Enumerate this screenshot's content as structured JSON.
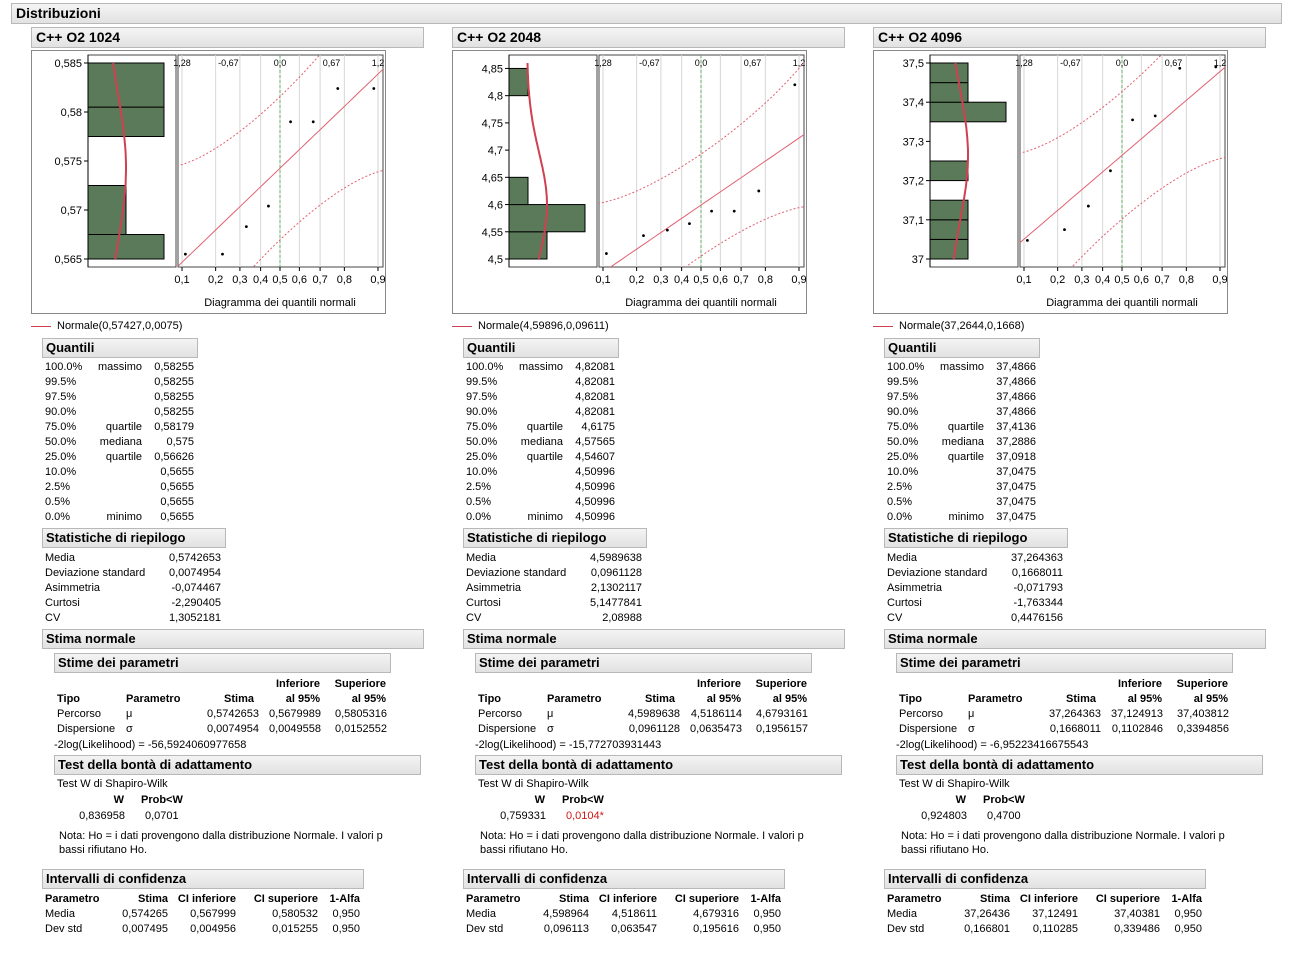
{
  "report_title": "Distribuzioni",
  "labels": {
    "quantiles_title": "Quantili",
    "summary_title": "Statistiche di riepilogo",
    "normal_fit_title": "Stima normale",
    "param_est_title": "Stime dei parametri",
    "gof_title": "Test della bontà di adattamento",
    "ci_title": "Intervalli di confidenza",
    "qq_axis_label": "Diagramma dei quantili normali",
    "qq_top_ticks": [
      "1,28",
      "-0,67",
      "0,0",
      "0,67",
      "1,2"
    ],
    "qq_bottom_ticks": [
      "0,1",
      "0,2",
      "0,3",
      "0,4",
      "0,5",
      "0,6",
      "0,7",
      "0,8",
      "0,9"
    ],
    "quantile_levels": [
      "100.0%",
      "99.5%",
      "97.5%",
      "90.0%",
      "75.0%",
      "50.0%",
      "25.0%",
      "10.0%",
      "2.5%",
      "0.5%",
      "0.0%"
    ],
    "quantile_names": [
      "massimo",
      "",
      "",
      "",
      "quartile",
      "mediana",
      "quartile",
      "",
      "",
      "",
      "minimo"
    ],
    "summary_names": [
      "Media",
      "Deviazione standard",
      "Asimmetria",
      "Curtosi",
      "CV"
    ],
    "pe_headers": {
      "tipo": "Tipo",
      "param": "Parametro",
      "stima": "Stima",
      "inf1": "Inferiore",
      "inf2": "al 95%",
      "sup1": "Superiore",
      "sup2": "al 95%"
    },
    "pe_types": [
      "Percorso",
      "Dispersione"
    ],
    "pe_params": [
      "μ",
      "σ"
    ],
    "loglik_prefix": "-2log(Likelihood) = ",
    "sw_test_name": "Test W di Shapiro-Wilk",
    "sw_w": "W",
    "sw_prob": "Prob<W",
    "gof_note_1": "Nota: Ho = i dati provengono dalla distribuzione Normale. I valori p",
    "gof_note_2": "bassi rifiutano Ho.",
    "ci_headers": [
      "Parametro",
      "Stima",
      "CI inferiore",
      "CI superiore",
      "1-Alfa"
    ],
    "ci_params": [
      "Media",
      "Dev std"
    ]
  },
  "colors": {
    "bar_fill": "#5a7a5a",
    "normal_curve": "#d04050",
    "ref_line": "#e06070",
    "median_line": "#60b060"
  },
  "panels": [
    {
      "title": "C++ O2 1024",
      "y_ticks": [
        "0,585",
        "0,58",
        "0,575",
        "0,57",
        "0,565"
      ],
      "y_range": [
        0.565,
        0.585
      ],
      "y_tick_values": [
        0.585,
        0.58,
        0.575,
        0.57,
        0.565
      ],
      "bins": [
        {
          "lo": 0.565,
          "hi": 0.5675,
          "rel": 1.0
        },
        {
          "lo": 0.5675,
          "hi": 0.5725,
          "rel": 0.5
        },
        {
          "lo": 0.5775,
          "hi": 0.5805,
          "rel": 1.0
        },
        {
          "lo": 0.5805,
          "hi": 0.585,
          "rel": 1.0
        }
      ],
      "qq_points": [
        [
          0.108,
          0.5655
        ],
        [
          0.226,
          0.5655
        ],
        [
          0.33,
          0.5683
        ],
        [
          0.44,
          0.5704
        ],
        [
          0.555,
          0.579
        ],
        [
          0.668,
          0.579
        ],
        [
          0.775,
          0.5824
        ],
        [
          0.89,
          0.5824
        ]
      ],
      "legend": "Normale(0,57427,0,0075)",
      "mean": 0.5742653,
      "sd": 0.0074954,
      "quantile_values": [
        "0,58255",
        "0,58255",
        "0,58255",
        "0,58255",
        "0,58179",
        "0,575",
        "0,56626",
        "0,5655",
        "0,5655",
        "0,5655",
        "0,5655"
      ],
      "summary_values": [
        "0,5742653",
        "0,0074954",
        "-0,074467",
        "-2,290405",
        "1,3052181"
      ],
      "pe_rows": [
        [
          "0,5742653",
          "0,5679989",
          "0,5805316"
        ],
        [
          "0,0074954",
          "0,0049558",
          "0,0152552"
        ]
      ],
      "loglik": "-56,5924060977658",
      "sw": {
        "w": "0,836958",
        "p": "0,0701",
        "sig": false
      },
      "ci_rows": [
        [
          "0,574265",
          "0,567999",
          "0,580532",
          "0,950"
        ],
        [
          "0,007495",
          "0,004956",
          "0,015255",
          "0,950"
        ]
      ]
    },
    {
      "title": "C++ O2 2048",
      "y_ticks": [
        "4,85",
        "4,8",
        "4,75",
        "4,7",
        "4,65",
        "4,6",
        "4,55",
        "4,5"
      ],
      "y_range": [
        4.5,
        4.86
      ],
      "y_tick_values": [
        4.85,
        4.8,
        4.75,
        4.7,
        4.65,
        4.6,
        4.55,
        4.5
      ],
      "bins": [
        {
          "lo": 4.5,
          "hi": 4.55,
          "rel": 0.5
        },
        {
          "lo": 4.55,
          "hi": 4.6,
          "rel": 1.0
        },
        {
          "lo": 4.6,
          "hi": 4.65,
          "rel": 0.25
        },
        {
          "lo": 4.8,
          "hi": 4.85,
          "rel": 0.25
        }
      ],
      "qq_points": [
        [
          0.108,
          4.51
        ],
        [
          0.226,
          4.543
        ],
        [
          0.33,
          4.553
        ],
        [
          0.44,
          4.565
        ],
        [
          0.555,
          4.588
        ],
        [
          0.668,
          4.588
        ],
        [
          0.775,
          4.625
        ],
        [
          0.89,
          4.82
        ]
      ],
      "legend": "Normale(4,59896,0,09611)",
      "mean": 4.5989638,
      "sd": 0.0961128,
      "quantile_values": [
        "4,82081",
        "4,82081",
        "4,82081",
        "4,82081",
        "4,6175",
        "4,57565",
        "4,54607",
        "4,50996",
        "4,50996",
        "4,50996",
        "4,50996"
      ],
      "summary_values": [
        "4,5989638",
        "0,0961128",
        "2,1302117",
        "5,1477841",
        "2,08988"
      ],
      "pe_rows": [
        [
          "4,5989638",
          "4,5186114",
          "4,6793161"
        ],
        [
          "0,0961128",
          "0,0635473",
          "0,1956157"
        ]
      ],
      "loglik": "-15,772703931443",
      "sw": {
        "w": "0,759331",
        "p": "0,0104*",
        "sig": true
      },
      "ci_rows": [
        [
          "4,598964",
          "4,518611",
          "4,679316",
          "0,950"
        ],
        [
          "0,096113",
          "0,063547",
          "0,195616",
          "0,950"
        ]
      ]
    },
    {
      "title": "C++ O2 4096",
      "y_ticks": [
        "37,5",
        "37,4",
        "37,3",
        "37,2",
        "37,1",
        "37"
      ],
      "y_range": [
        37.0,
        37.5
      ],
      "y_tick_values": [
        37.5,
        37.4,
        37.3,
        37.2,
        37.1,
        37.0
      ],
      "bins": [
        {
          "lo": 37.0,
          "hi": 37.05,
          "rel": 0.5
        },
        {
          "lo": 37.05,
          "hi": 37.1,
          "rel": 0.5
        },
        {
          "lo": 37.1,
          "hi": 37.15,
          "rel": 0.5
        },
        {
          "lo": 37.2,
          "hi": 37.25,
          "rel": 0.5
        },
        {
          "lo": 37.35,
          "hi": 37.4,
          "rel": 1.0
        },
        {
          "lo": 37.4,
          "hi": 37.45,
          "rel": 0.5
        },
        {
          "lo": 37.45,
          "hi": 37.5,
          "rel": 0.5
        }
      ],
      "qq_points": [
        [
          0.108,
          37.0475
        ],
        [
          0.226,
          37.075
        ],
        [
          0.33,
          37.135
        ],
        [
          0.44,
          37.225
        ],
        [
          0.555,
          37.355
        ],
        [
          0.668,
          37.365
        ],
        [
          0.775,
          37.4866
        ],
        [
          0.89,
          37.49
        ]
      ],
      "legend": "Normale(37,2644,0,1668)",
      "mean": 37.264363,
      "sd": 0.1668011,
      "quantile_values": [
        "37,4866",
        "37,4866",
        "37,4866",
        "37,4866",
        "37,4136",
        "37,2886",
        "37,0918",
        "37,0475",
        "37,0475",
        "37,0475",
        "37,0475"
      ],
      "summary_values": [
        "37,264363",
        "0,1668011",
        "-0,071793",
        "-1,763344",
        "0,4476156"
      ],
      "pe_rows": [
        [
          "37,264363",
          "37,124913",
          "37,403812"
        ],
        [
          "0,1668011",
          "0,1102846",
          "0,3394856"
        ]
      ],
      "loglik": "-6,95223416675543",
      "sw": {
        "w": "0,924803",
        "p": "0,4700",
        "sig": false
      },
      "ci_rows": [
        [
          "37,26436",
          "37,12491",
          "37,40381",
          "0,950"
        ],
        [
          "0,166801",
          "0,110285",
          "0,339486",
          "0,950"
        ]
      ]
    }
  ]
}
